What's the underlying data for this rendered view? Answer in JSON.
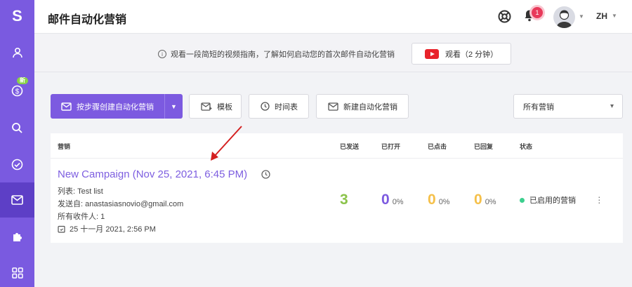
{
  "sidebar": {
    "logo": "S",
    "badge": "新",
    "items": [
      "contacts",
      "pricing",
      "search",
      "tasks",
      "email-automation",
      "integrations",
      "apps"
    ]
  },
  "header": {
    "title": "邮件自动化营销",
    "notifications": "1",
    "language": "ZH"
  },
  "banner": {
    "text": "观看一段简短的视频指南，了解如何启动您的首次邮件自动化营销",
    "watch_label": "观看（2 分钟）"
  },
  "toolbar": {
    "create_label": "按步骤创建自动化营销",
    "templates_label": "模板",
    "schedule_label": "时间表",
    "new_label": "新建自动化营销",
    "filter_value": "所有营销"
  },
  "table": {
    "headers": {
      "campaign": "营销",
      "sent": "已发送",
      "opened": "已打开",
      "clicked": "已点击",
      "replied": "已回复",
      "status": "状态"
    },
    "row": {
      "name": "New Campaign (Nov 25, 2021, 6:45 PM)",
      "list": "列表: Test list",
      "from": "发送自: anastasiasnovio@gmail.com",
      "recipients": "所有收件人: 1",
      "date": "25 十一月 2021, 2:56 PM",
      "sent": "3",
      "opened": "0",
      "opened_pct": "0%",
      "clicked": "0",
      "clicked_pct": "0%",
      "replied": "0",
      "replied_pct": "0%",
      "status": "已启用的营销"
    }
  },
  "colors": {
    "accent": "#7c5ae0",
    "sent": "#8bc34a",
    "opened": "#7c5ae0",
    "clicked": "#f5c04a",
    "replied": "#f5c04a",
    "status_active": "#3ccf8e"
  }
}
